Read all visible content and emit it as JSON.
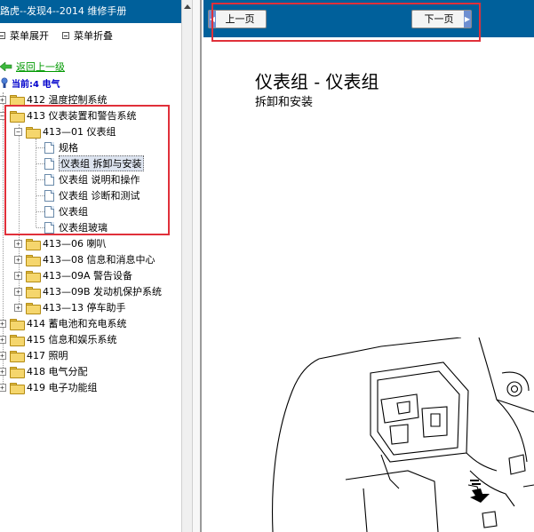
{
  "app": {
    "title": "路虎--发现4--2014 维修手册"
  },
  "menu": {
    "expand_label": "菜单展开",
    "collapse_label": "菜单折叠"
  },
  "tree": {
    "back_label": "返回上一级",
    "current_label": "当前:4 电气",
    "items": [
      {
        "label": "412 温度控制系统"
      },
      {
        "label": "413 仪表装置和警告系统"
      },
      {
        "label": "413—01 仪表组"
      },
      {
        "label": "规格"
      },
      {
        "label": "仪表组 拆卸与安装"
      },
      {
        "label": "仪表组 说明和操作"
      },
      {
        "label": "仪表组 诊断和测试"
      },
      {
        "label": "仪表组"
      },
      {
        "label": "仪表组玻璃"
      },
      {
        "label": "413—06 喇叭"
      },
      {
        "label": "413—08 信息和消息中心"
      },
      {
        "label": "413—09A 警告设备"
      },
      {
        "label": "413—09B 发动机保护系统"
      },
      {
        "label": "413—13 停车助手"
      },
      {
        "label": "414 蓄电池和充电系统"
      },
      {
        "label": "415 信息和娱乐系统"
      },
      {
        "label": "417 照明"
      },
      {
        "label": "418 电气分配"
      },
      {
        "label": "419 电子功能组"
      }
    ]
  },
  "nav": {
    "prev_label": "上一页",
    "next_label": "下一页"
  },
  "document": {
    "title": "仪表组 - 仪表组",
    "subtitle": "拆卸和安装"
  },
  "colors": {
    "header_bar": "#00609b",
    "highlight_box": "#e0303a",
    "back_link": "#009900",
    "current_label": "#0000cc"
  }
}
